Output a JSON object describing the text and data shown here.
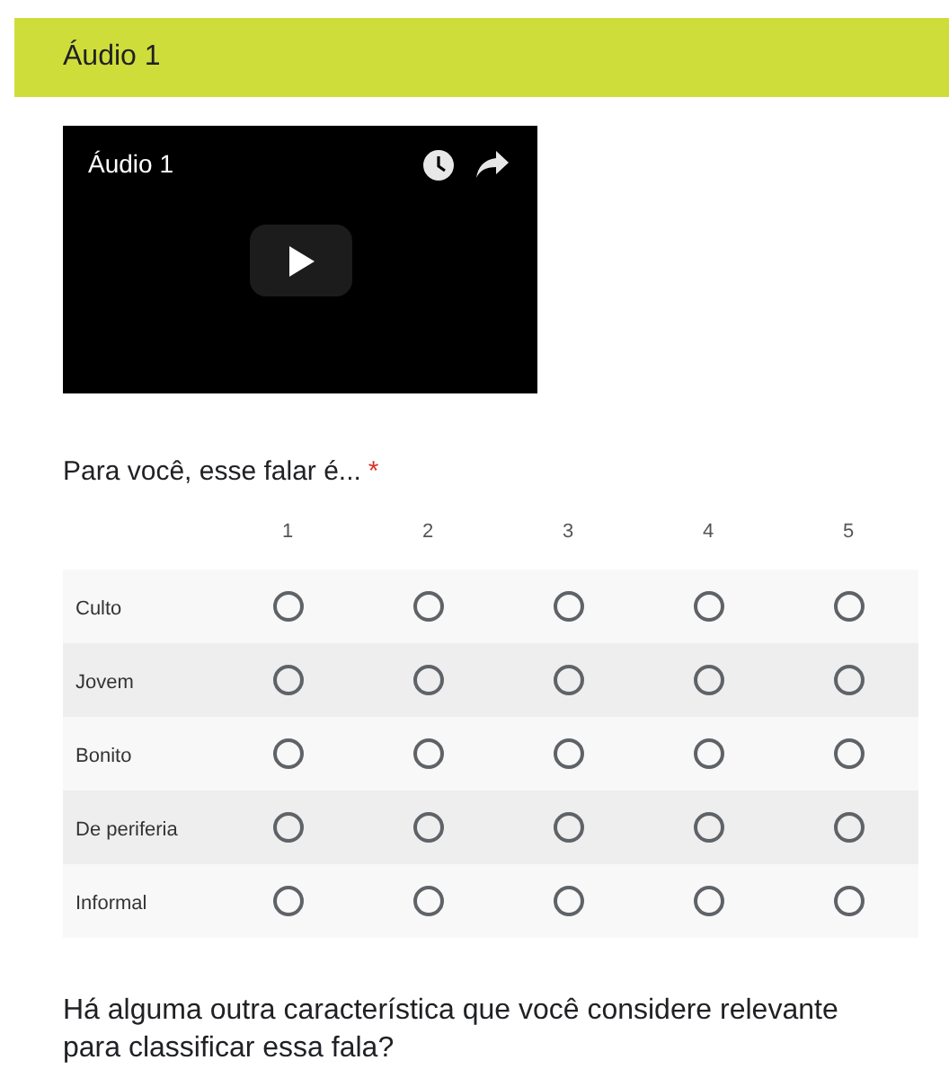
{
  "section": {
    "title": "Áudio 1"
  },
  "video": {
    "title": "Áudio 1"
  },
  "question": {
    "text": "Para você, esse falar é...",
    "required": true,
    "required_mark": "*",
    "columns": [
      "1",
      "2",
      "3",
      "4",
      "5"
    ],
    "rows": [
      {
        "label": "Culto",
        "choices": [
          {
            "selected": false
          },
          {
            "selected": false
          },
          {
            "selected": false
          },
          {
            "selected": false
          },
          {
            "selected": false
          }
        ]
      },
      {
        "label": "Jovem",
        "choices": [
          {
            "selected": false
          },
          {
            "selected": false
          },
          {
            "selected": false
          },
          {
            "selected": false
          },
          {
            "selected": false
          }
        ]
      },
      {
        "label": "Bonito",
        "choices": [
          {
            "selected": false
          },
          {
            "selected": false
          },
          {
            "selected": false
          },
          {
            "selected": false
          },
          {
            "selected": false
          }
        ]
      },
      {
        "label": "De periferia",
        "choices": [
          {
            "selected": false
          },
          {
            "selected": false
          },
          {
            "selected": false
          },
          {
            "selected": false
          },
          {
            "selected": false
          }
        ]
      },
      {
        "label": "Informal",
        "choices": [
          {
            "selected": false
          },
          {
            "selected": false
          },
          {
            "selected": false
          },
          {
            "selected": false
          },
          {
            "selected": false
          }
        ]
      }
    ]
  },
  "next_question": {
    "text": "Há alguma outra característica que você considere relevante para classificar essa fala?"
  }
}
